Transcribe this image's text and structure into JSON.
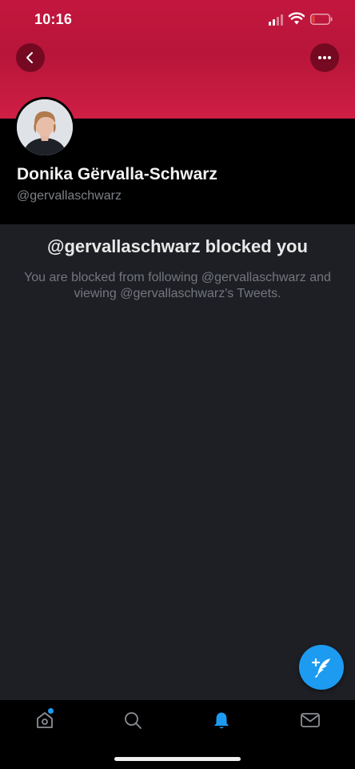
{
  "status_bar": {
    "time": "10:16",
    "icons": [
      "cellular-signal-icon",
      "wifi-icon",
      "battery-icon"
    ],
    "battery_color": "#e0433a"
  },
  "nav": {
    "back_icon": "chevron-left-icon",
    "more_icon": "more-horizontal-icon"
  },
  "profile": {
    "banner_color": "#c3163e",
    "display_name": "Donika Gërvalla-Schwarz",
    "handle": "@gervallaschwarz"
  },
  "blocked": {
    "title": "@gervallaschwarz blocked you",
    "description": "You are blocked from following @gervallaschwarz and viewing @gervallaschwarz's Tweets."
  },
  "fab": {
    "icon": "compose-tweet-icon",
    "color": "#1d9bf0"
  },
  "tab_bar": {
    "tabs": [
      {
        "name": "home",
        "icon": "home-icon",
        "has_badge": true
      },
      {
        "name": "search",
        "icon": "search-icon"
      },
      {
        "name": "notifications",
        "icon": "bell-icon",
        "active": true
      },
      {
        "name": "messages",
        "icon": "mail-icon"
      }
    ],
    "active_color": "#1d9bf0"
  }
}
